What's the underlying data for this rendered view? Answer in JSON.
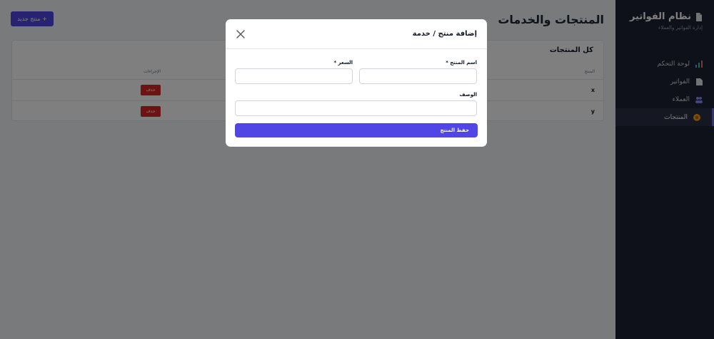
{
  "sidebar": {
    "brand_title": "نظام الفواتير",
    "brand_subtitle": "إدارة الفواتير والعملاء",
    "items": [
      {
        "label": "لوحة التحكم",
        "icon": "dashboard-icon"
      },
      {
        "label": "الفواتير",
        "icon": "document-icon"
      },
      {
        "label": "العملاء",
        "icon": "users-icon"
      },
      {
        "label": "المنتجات",
        "icon": "box-icon",
        "active": true
      }
    ]
  },
  "main": {
    "page_title": "المنتجات والخدمات",
    "new_button_label": "+ منتج جديد",
    "card_title": "كل المنتجات",
    "table": {
      "headers": {
        "name": "المنتج",
        "actions": "الإجراءات"
      },
      "rows": [
        {
          "name": "x",
          "delete_label": "حذف"
        },
        {
          "name": "y",
          "delete_label": "حذف"
        }
      ]
    }
  },
  "modal": {
    "title": "إضافة منتج / خدمة",
    "fields": {
      "name_label": "اسم المنتج *",
      "name_value": "",
      "price_label": "السعر *",
      "price_value": "",
      "description_label": "الوصف",
      "description_value": ""
    },
    "save_label": "حفظ المنتج"
  },
  "colors": {
    "primary": "#4f46e5",
    "danger": "#dc2626",
    "sidebar_bg": "#1e2235"
  }
}
